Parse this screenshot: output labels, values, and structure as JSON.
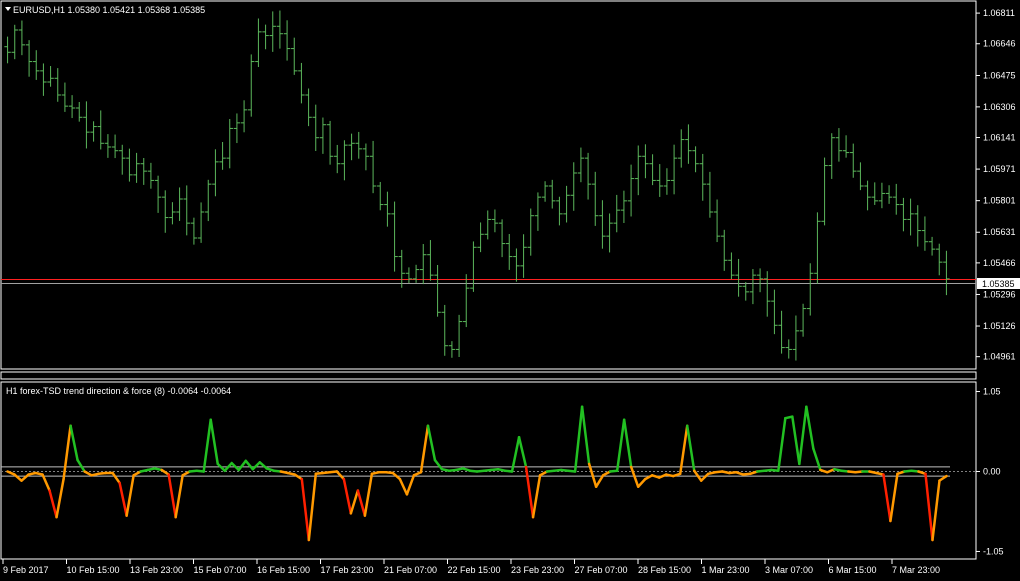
{
  "window": {
    "symbol_info": "EURUSD,H1  1.05380 1.05421 1.05368 1.05385",
    "indicator_title": "H1 forex-TSD trend direction & force (8) -0.0064 -0.0064",
    "current_price_label": "1.05385"
  },
  "colors": {
    "background": "#000000",
    "bars": "#5cb85c",
    "grid_frame": "#ffffff",
    "price_line_red": "#ff2020",
    "price_line_gray": "#a0a0a0",
    "indicator_up": "#22c022",
    "indicator_down": "#ff2000",
    "indicator_mid": "#ff9900"
  },
  "chart_data": [
    {
      "type": "ohlc",
      "title": "EURUSD,H1",
      "ylim": [
        1.049,
        1.0686
      ],
      "yticks": [
        "1.06811",
        "1.06646",
        "1.06475",
        "1.06306",
        "1.06141",
        "1.05971",
        "1.05801",
        "1.05631",
        "1.05466",
        "1.05296",
        "1.05126",
        "1.04961"
      ],
      "series": [
        {
          "name": "",
          "close": [
            1.066,
            1.0672,
            1.0664,
            1.0655,
            1.065,
            1.0644,
            1.0646,
            1.0637,
            1.0631,
            1.063,
            1.0625,
            1.0617,
            1.062,
            1.0611,
            1.0609,
            1.0607,
            1.0603,
            1.0594,
            1.06,
            1.0596,
            1.0591,
            1.0582,
            1.0571,
            1.0574,
            1.0581,
            1.0568,
            1.056,
            1.0574,
            1.0589,
            1.0601,
            1.0603,
            1.0619,
            1.0622,
            1.0629,
            1.0655,
            1.0671,
            1.0669,
            1.0674,
            1.067,
            1.0662,
            1.065,
            1.0637,
            1.0625,
            1.0614,
            1.0621,
            1.0604,
            1.06,
            1.061,
            1.0611,
            1.0608,
            1.0604,
            1.0588,
            1.0578,
            1.0573,
            1.055,
            1.0541,
            1.0538,
            1.0543,
            1.0551,
            1.054,
            1.052,
            1.0502,
            1.05,
            1.0515,
            1.0533,
            1.0555,
            1.0562,
            1.057,
            1.0568,
            1.0557,
            1.055,
            1.0545,
            1.0555,
            1.0572,
            1.0582,
            1.0588,
            1.058,
            1.0573,
            1.0583,
            1.0595,
            1.0603,
            1.0589,
            1.0572,
            1.0561,
            1.0568,
            1.0575,
            1.058,
            1.0592,
            1.0604,
            1.06,
            1.0591,
            1.0588,
            1.0591,
            1.0603,
            1.0613,
            1.0607,
            1.06,
            1.0589,
            1.0574,
            1.0561,
            1.0548,
            1.054,
            1.0534,
            1.0531,
            1.054,
            1.0538,
            1.0526,
            1.0513,
            1.0501,
            1.05,
            1.051,
            1.0522,
            1.0541,
            1.0569,
            1.0599,
            1.0614,
            1.0607,
            1.0606,
            1.0596,
            1.0588,
            1.0582,
            1.058,
            1.0584,
            1.0582,
            1.0578,
            1.057,
            1.0573,
            1.0564,
            1.0558,
            1.0554,
            1.0547,
            1.0538
          ]
        }
      ]
    },
    {
      "type": "line",
      "title": "H1 forex-TSD trend direction & force (8)",
      "ylim": [
        -0.107,
        0.107
      ],
      "yticks": [
        "1.05",
        "0.00",
        "-1.05"
      ],
      "levels": [
        0.006,
        -0.006
      ],
      "series": [
        {
          "name": "",
          "values": [
            0.0,
            -0.004,
            -0.012,
            -0.004,
            -0.002,
            -0.004,
            -0.025,
            -0.06,
            -0.01,
            0.06,
            0.015,
            0.0,
            -0.005,
            -0.003,
            -0.002,
            -0.002,
            -0.015,
            -0.058,
            -0.005,
            0.0,
            0.002,
            0.004,
            0.002,
            -0.004,
            -0.06,
            -0.005,
            0.0,
            0.001,
            0.0,
            0.068,
            0.01,
            0.001,
            0.011,
            0.002,
            0.014,
            0.003,
            0.012,
            0.004,
            0.001,
            0.0,
            -0.002,
            -0.004,
            -0.01,
            -0.09,
            -0.003,
            -0.002,
            -0.001,
            0.0,
            -0.01,
            -0.055,
            -0.025,
            -0.058,
            -0.003,
            -0.001,
            -0.001,
            -0.002,
            -0.01,
            -0.03,
            -0.005,
            -0.001,
            0.06,
            0.015,
            0.003,
            0.001,
            0.002,
            0.004,
            0.001,
            0.0,
            0.001,
            0.002,
            0.003,
            0.001,
            0.0,
            0.045,
            0.006,
            -0.06,
            -0.005,
            0.0,
            0.001,
            0.002,
            0.001,
            0.0,
            0.085,
            0.01,
            -0.02,
            -0.005,
            0.0,
            0.001,
            0.068,
            0.006,
            -0.02,
            -0.01,
            -0.005,
            -0.008,
            -0.004,
            -0.006,
            -0.003,
            0.06,
            0.001,
            -0.012,
            -0.003,
            -0.001,
            0.0,
            -0.002,
            -0.001,
            -0.004,
            -0.003,
            0.0,
            0.001,
            0.002,
            0.001,
            0.07,
            0.072,
            0.01,
            0.085,
            0.03,
            0.002,
            -0.001,
            0.003,
            0.001,
            0.0,
            -0.001,
            0.0,
            0.0,
            -0.002,
            -0.004,
            -0.065,
            -0.003,
            0.0,
            0.001,
            0.0,
            -0.003,
            -0.09,
            -0.012,
            -0.006
          ]
        }
      ]
    }
  ],
  "x_axis_labels": [
    "9 Feb 2017",
    "10 Feb 15:00",
    "13 Feb 23:00",
    "15 Feb 07:00",
    "16 Feb 15:00",
    "17 Feb 23:00",
    "21 Feb 07:00",
    "22 Feb 15:00",
    "23 Feb 23:00",
    "27 Feb 07:00",
    "28 Feb 15:00",
    "1 Mar 23:00",
    "3 Mar 07:00",
    "6 Mar 15:00",
    "7 Mar 23:00"
  ]
}
